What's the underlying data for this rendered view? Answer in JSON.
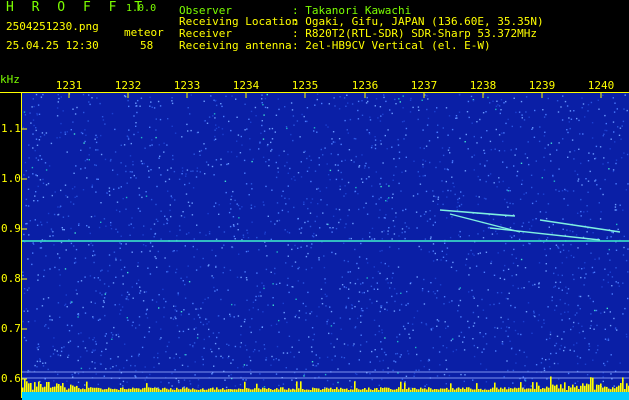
{
  "header": {
    "app_title": "H R O F F T",
    "app_version": "1.0.0",
    "file_name": "2504251230.png",
    "datetime": "25.04.25 12:30",
    "mode_label": "meteor",
    "count_value": "58"
  },
  "station": [
    {
      "label": "Observer",
      "value": ": Takanori Kawachi"
    },
    {
      "label": "Receiving Location",
      "value": ": Ogaki, Gifu, JAPAN (136.60E, 35.35N)"
    },
    {
      "label": "Receiver",
      "value": ": R820T2(RTL-SDR) SDR-Sharp 53.372MHz"
    },
    {
      "label": "Receiving antenna",
      "value": ": 2el-HB9CV Vertical (el. E-W)"
    }
  ],
  "axis": {
    "unit": "kHz",
    "minutes": [
      "1231",
      "1232",
      "1233",
      "1234",
      "1235",
      "1236",
      "1237",
      "1238",
      "1239",
      "1240"
    ],
    "freq_ticks": [
      "1.1",
      "1.0",
      "0.9",
      "0.8",
      "0.7",
      "0.6"
    ]
  },
  "colors": {
    "text_green": "#7cff00",
    "text_yellow": "#ffff00",
    "background_noise": "#0a1fa6",
    "carrier_line": "#38d8c8",
    "level_fill": "#ffff00",
    "level_base": "#00ccff"
  }
}
